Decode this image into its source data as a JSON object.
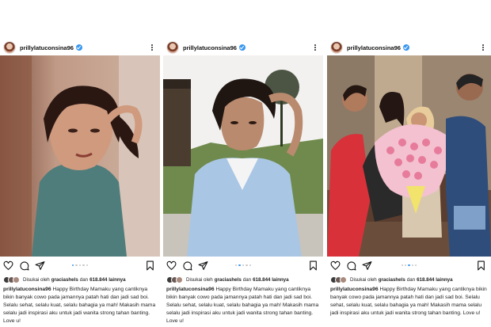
{
  "post": {
    "username": "prillylatuconsina96",
    "liked_by_prefix": "Disukai oleh",
    "liked_by_user": "graciashels",
    "liked_by_middle": "dan",
    "liked_by_count": "618.844 lainnya",
    "caption": "Happy Birthday Mamaku yang cantiknya bikin banyak cowo pada jamannya patah hati dan jadi sad boi. Selalu sehat, selalu kuat, selalu bahagia ya mah! Makasih mama selalu jadi inspirasi aku untuk jadi wanita strong tahan banting. Love u!"
  },
  "posts": [
    {
      "carousel_active_index": 1,
      "carousel_count": 5
    },
    {
      "carousel_active_index": 2,
      "carousel_count": 5
    },
    {
      "carousel_active_index": 3,
      "carousel_count": 5
    }
  ],
  "icons": {
    "like": "heart-icon",
    "comment": "comment-icon",
    "share": "paper-plane-icon",
    "save": "bookmark-icon",
    "more": "more-options-icon",
    "verified": "verified-badge-icon"
  },
  "colors": {
    "verified_blue": "#3897f0",
    "carousel_active": "#3897f0",
    "carousel_inactive": "#c7c7c7",
    "text": "#222222"
  }
}
